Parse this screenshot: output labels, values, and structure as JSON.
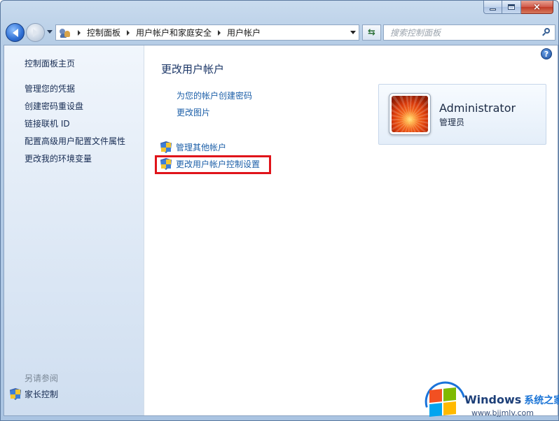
{
  "window": {
    "controls": {
      "minimize": "minimize",
      "maximize": "maximize",
      "close": "×"
    }
  },
  "nav": {
    "breadcrumbs": [
      "控制面板",
      "用户帐户和家庭安全",
      "用户帐户"
    ],
    "refresh_glyph": "⇆",
    "search_placeholder": "搜索控制面板"
  },
  "sidebar": {
    "items": [
      {
        "label": "控制面板主页"
      },
      {
        "label": "管理您的凭据"
      },
      {
        "label": "创建密码重设盘"
      },
      {
        "label": "链接联机 ID"
      },
      {
        "label": "配置高级用户配置文件属性"
      },
      {
        "label": "更改我的环境变量"
      }
    ],
    "see_also": "另请参阅",
    "parental_control": "家长控制"
  },
  "main": {
    "help": "?",
    "title": "更改用户帐户",
    "links": [
      {
        "label": "为您的帐户创建密码"
      },
      {
        "label": "更改图片"
      }
    ],
    "shield_links": [
      {
        "label": "管理其他帐户"
      },
      {
        "label": "更改用户帐户控制设置"
      }
    ],
    "user": {
      "name": "Administrator",
      "role": "管理员"
    }
  },
  "watermark": {
    "title": "Windows",
    "title_cn": "系统之家",
    "url": "www.bjjmlv.com"
  },
  "colors": {
    "highlight_box": "#e0141a",
    "link": "#1c5fa8",
    "title": "#1a3566"
  }
}
